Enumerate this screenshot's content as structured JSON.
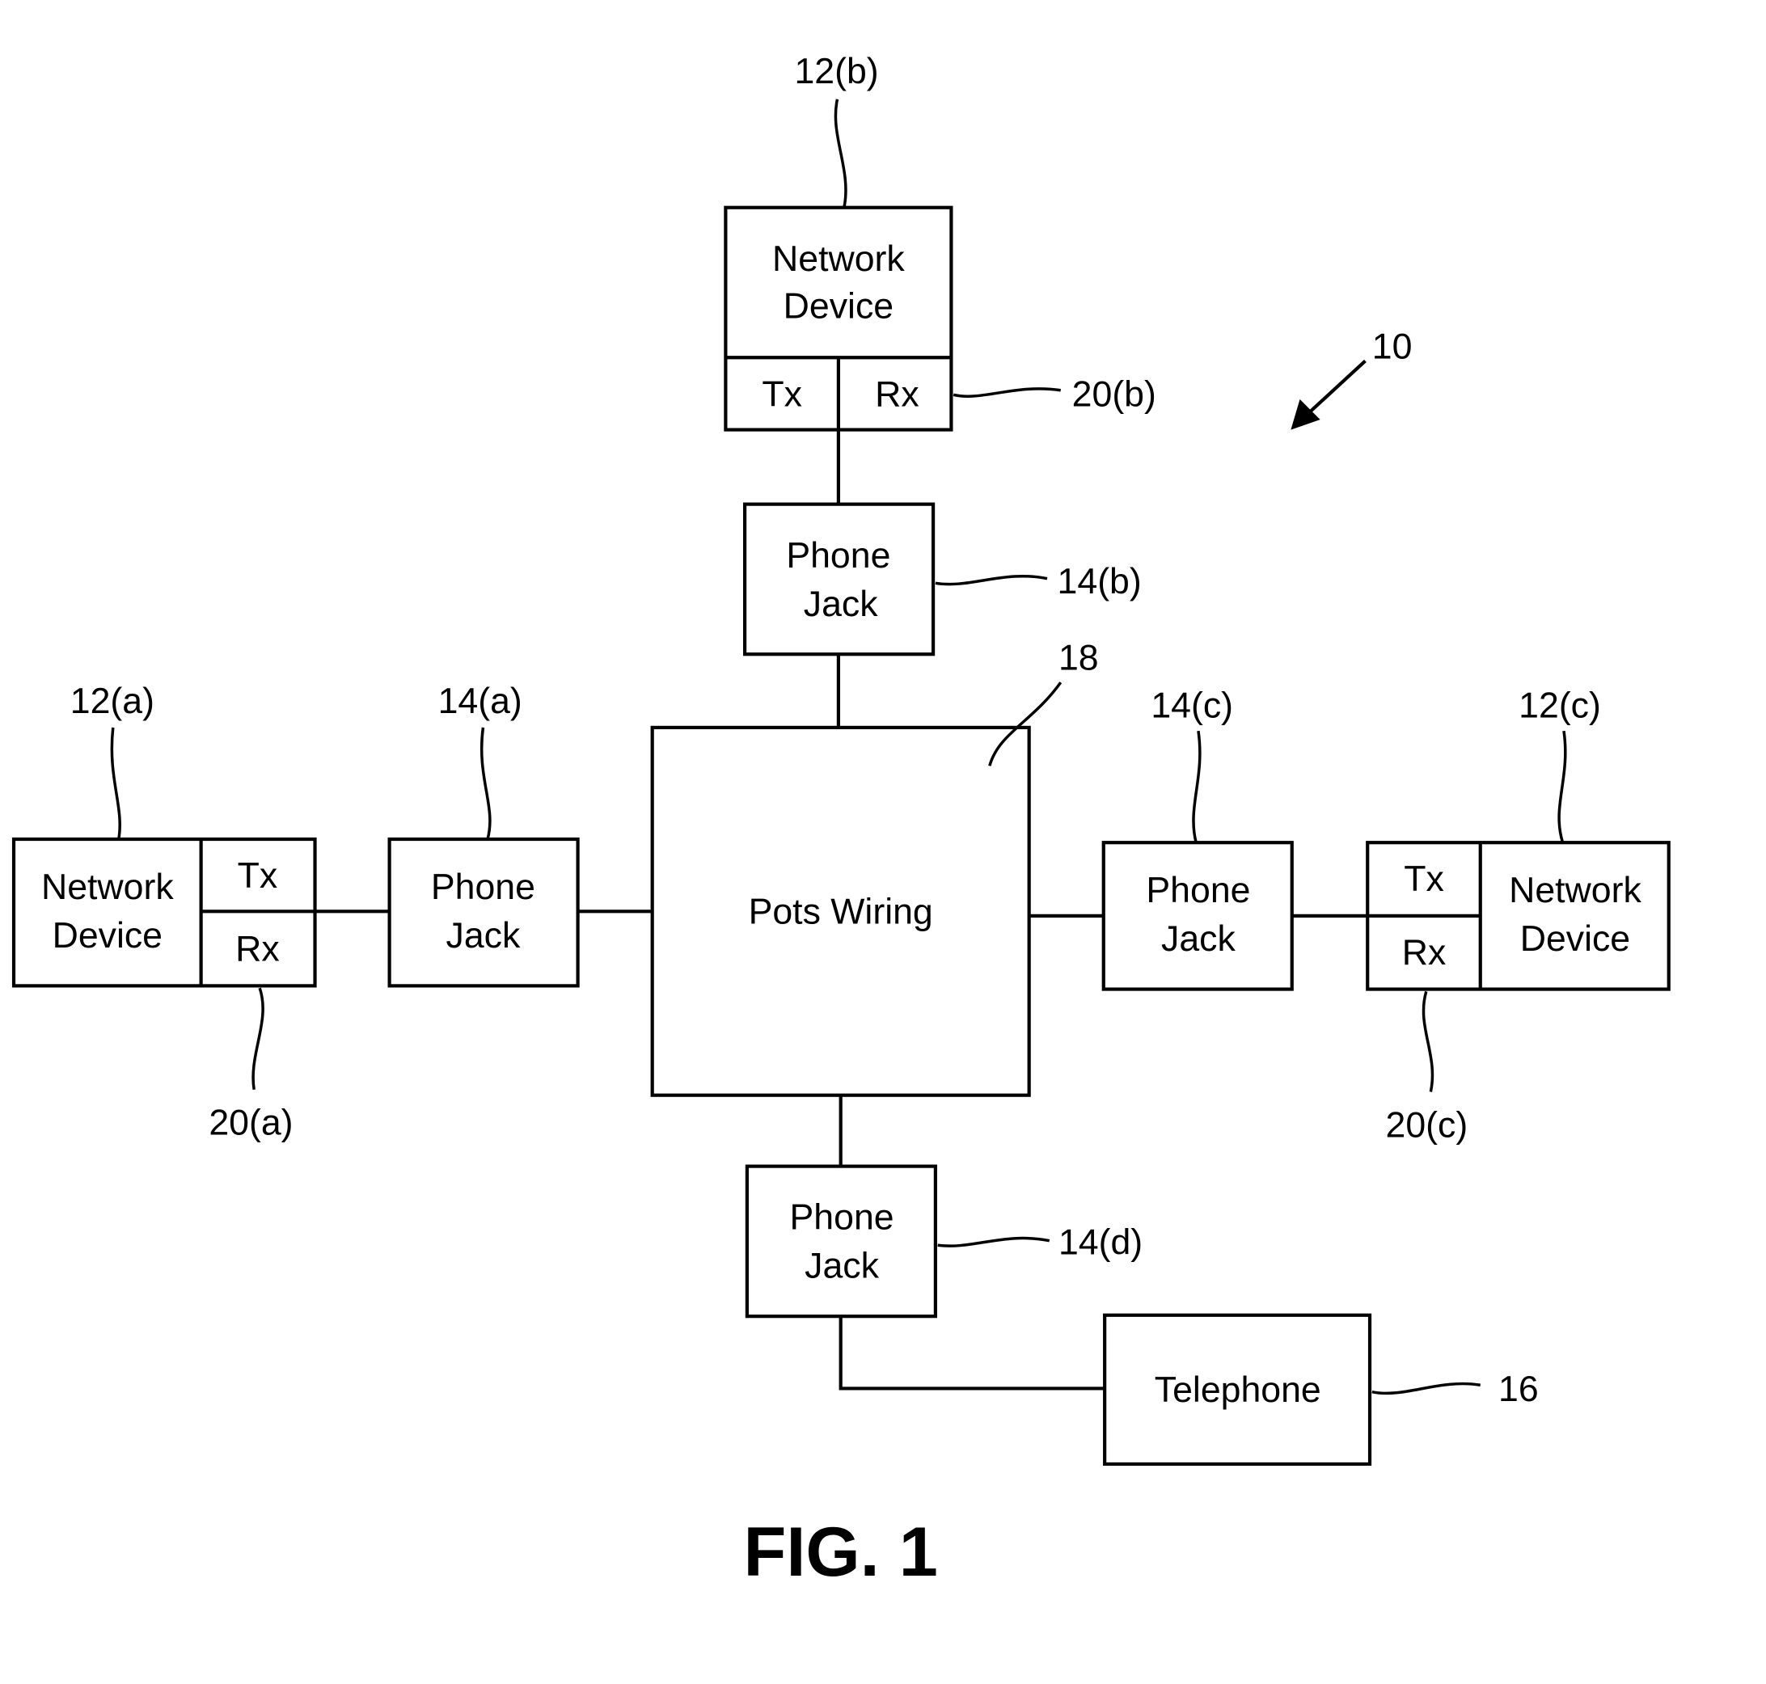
{
  "figure": {
    "caption": "FIG. 1",
    "system_ref": "10"
  },
  "pots_wiring": {
    "label": "Pots Wiring",
    "ref": "18"
  },
  "network_devices": [
    {
      "id": "a",
      "label_line1": "Network",
      "label_line2": "Device",
      "ref": "12(a)",
      "tx": "Tx",
      "rx": "Rx",
      "transceiver_ref": "20(a)"
    },
    {
      "id": "b",
      "label_line1": "Network",
      "label_line2": "Device",
      "ref": "12(b)",
      "tx": "Tx",
      "rx": "Rx",
      "transceiver_ref": "20(b)"
    },
    {
      "id": "c",
      "label_line1": "Network",
      "label_line2": "Device",
      "ref": "12(c)",
      "tx": "Tx",
      "rx": "Rx",
      "transceiver_ref": "20(c)"
    }
  ],
  "phone_jacks": [
    {
      "id": "a",
      "label_line1": "Phone",
      "label_line2": "Jack",
      "ref": "14(a)"
    },
    {
      "id": "b",
      "label_line1": "Phone",
      "label_line2": "Jack",
      "ref": "14(b)"
    },
    {
      "id": "c",
      "label_line1": "Phone",
      "label_line2": "Jack",
      "ref": "14(c)"
    },
    {
      "id": "d",
      "label_line1": "Phone",
      "label_line2": "Jack",
      "ref": "14(d)"
    }
  ],
  "telephone": {
    "label": "Telephone",
    "ref": "16"
  }
}
